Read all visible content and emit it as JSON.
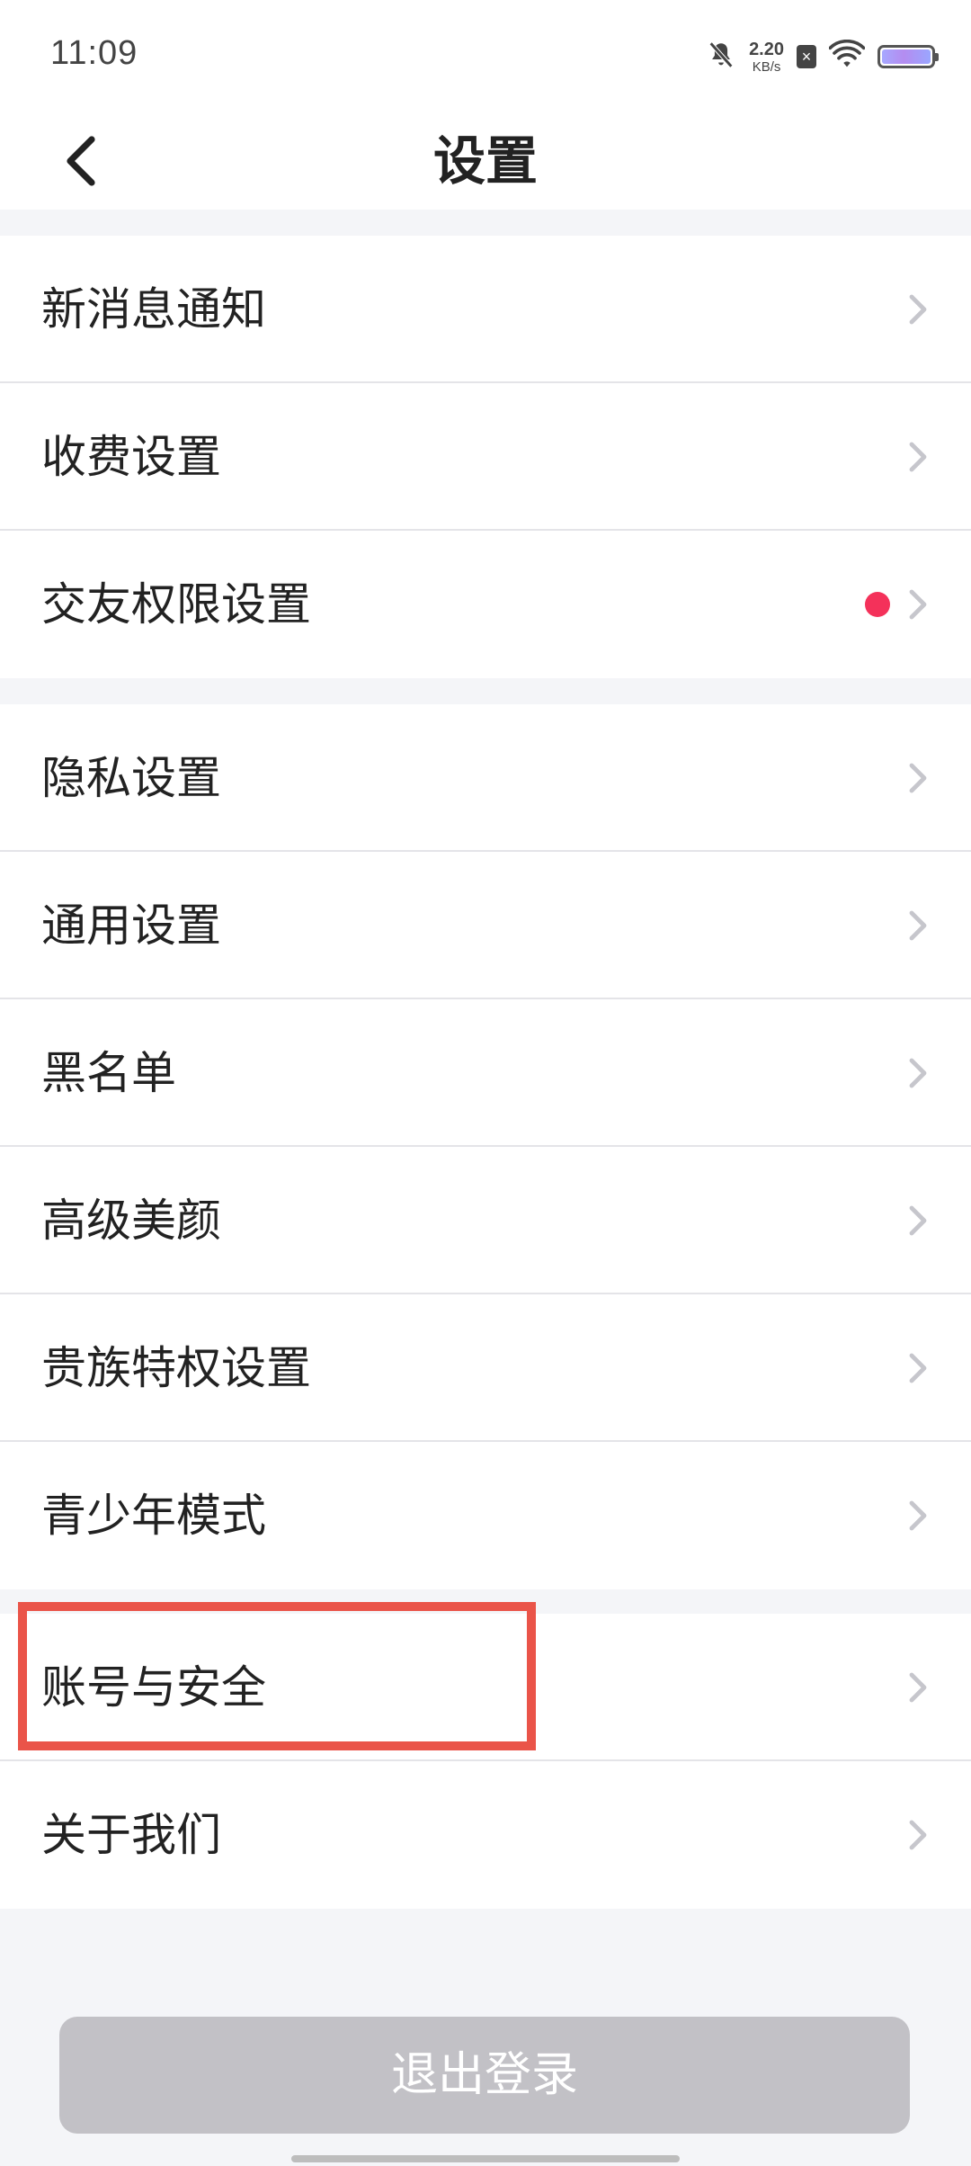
{
  "status": {
    "time": "11:09",
    "net_speed_value": "2.20",
    "net_speed_unit": "KB/s",
    "sim_badge": "×",
    "icons": [
      "bell-muted-icon",
      "sim-blocked-icon",
      "wifi-icon",
      "battery-icon"
    ]
  },
  "header": {
    "title": "设置",
    "back_icon": "chevron-left-icon"
  },
  "groups": [
    {
      "items": [
        {
          "label": "新消息通知"
        },
        {
          "label": "收费设置"
        },
        {
          "label": "交友权限设置",
          "badge": "red-dot"
        }
      ]
    },
    {
      "items": [
        {
          "label": "隐私设置"
        },
        {
          "label": "通用设置"
        },
        {
          "label": "黑名单"
        },
        {
          "label": "高级美颜"
        },
        {
          "label": "贵族特权设置"
        },
        {
          "label": "青少年模式"
        }
      ]
    },
    {
      "items": [
        {
          "label": "账号与安全",
          "highlighted": true
        },
        {
          "label": "关于我们"
        }
      ]
    }
  ],
  "logout_label": "退出登录",
  "colors": {
    "accent_red_dot": "#f4315a",
    "highlight_border": "#ea5449",
    "logout_bg": "#c2c1c6",
    "page_bg": "#f4f5f8"
  }
}
